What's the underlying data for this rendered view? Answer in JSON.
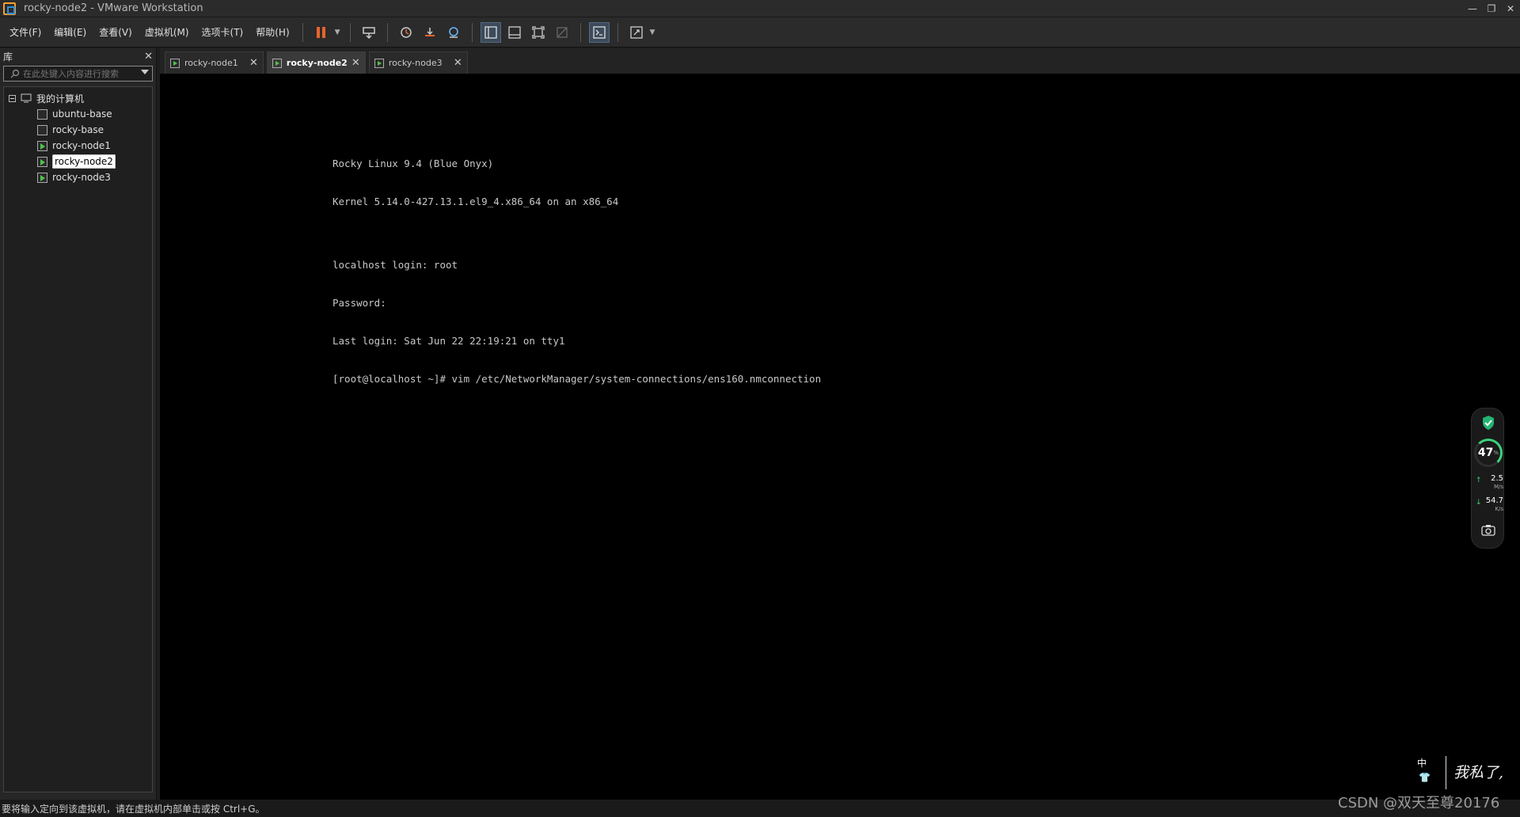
{
  "window": {
    "title": "rocky-node2 - VMware Workstation",
    "controls": [
      "—",
      "❐",
      "✕"
    ]
  },
  "menu": {
    "items": [
      "文件(F)",
      "编辑(E)",
      "查看(V)",
      "虚拟机(M)",
      "选项卡(T)",
      "帮助(H)"
    ]
  },
  "toolbar": {
    "icons": [
      "pause-icon",
      "send-ctrl-alt-del-icon",
      "snapshot-icon",
      "revert-snapshot-icon",
      "snapshot-manager-icon",
      "show-library-icon",
      "thumbnail-bar-icon",
      "full-screen-icon",
      "unity-icon",
      "console-view-icon",
      "stretch-guest-icon"
    ],
    "accent": "#e9642b"
  },
  "library": {
    "title": "库",
    "search_placeholder": "在此处键入内容进行搜索",
    "root_label": "我的计算机",
    "vms": [
      {
        "name": "ubuntu-base",
        "running": false
      },
      {
        "name": "rocky-base",
        "running": false
      },
      {
        "name": "rocky-node1",
        "running": true
      },
      {
        "name": "rocky-node2",
        "running": true,
        "selected": true
      },
      {
        "name": "rocky-node3",
        "running": true
      }
    ]
  },
  "tabs": [
    {
      "label": "rocky-node1",
      "active": false
    },
    {
      "label": "rocky-node2",
      "active": true
    },
    {
      "label": "rocky-node3",
      "active": false
    }
  ],
  "terminal": {
    "lines": [
      "Rocky Linux 9.4 (Blue Onyx)",
      "Kernel 5.14.0-427.13.1.el9_4.x86_64 on an x86_64",
      "",
      "localhost login: root",
      "Password:",
      "Last login: Sat Jun 22 22:19:21 on tty1",
      "[root@localhost ~]# vim /etc/NetworkManager/system-connections/ens160.nmconnection"
    ]
  },
  "status": {
    "text": "要将输入定向到该虚拟机，请在虚拟机内部单击或按 Ctrl+G。"
  },
  "widget": {
    "percent": "47",
    "percent_unit": "%",
    "upload": "2.5",
    "upload_unit": "M/s",
    "download": "54.7",
    "download_unit": "K/s",
    "accent": "#3bd17b"
  },
  "ime": {
    "mode": "中",
    "handwriting": "我私了,"
  },
  "watermark": "CSDN @双天至尊20176"
}
